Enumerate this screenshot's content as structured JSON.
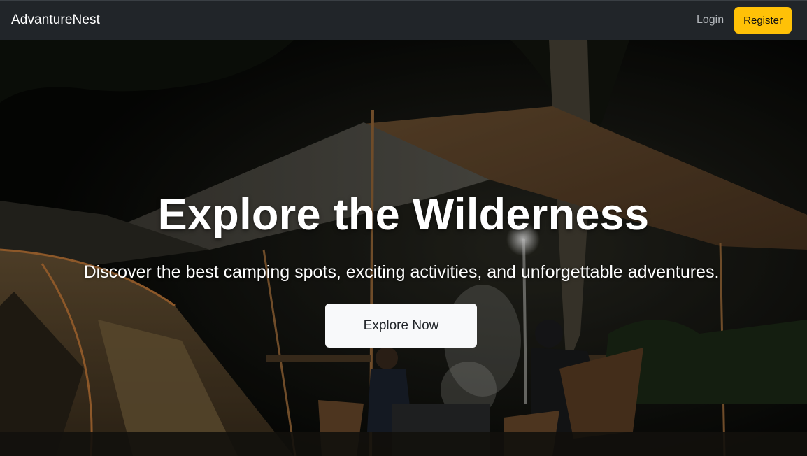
{
  "navbar": {
    "brand": "AdvantureNest",
    "login_label": "Login",
    "register_label": "Register"
  },
  "hero": {
    "title": "Explore the Wilderness",
    "subtitle": "Discover the best camping spots, exciting activities, and unforgettable adventures.",
    "cta_label": "Explore Now"
  },
  "colors": {
    "navbar_bg": "#212529",
    "register_bg": "#ffc107",
    "cta_bg": "#f8f9fa",
    "hero_text": "#ffffff"
  }
}
